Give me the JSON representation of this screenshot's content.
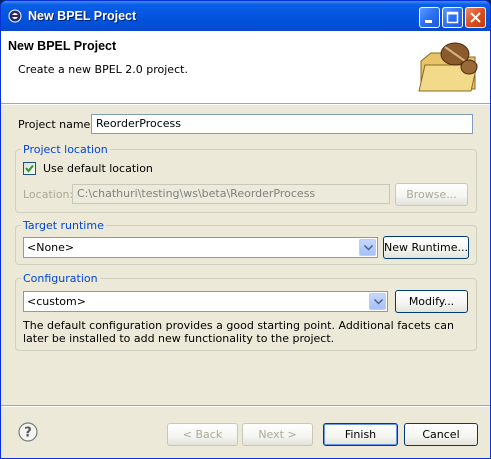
{
  "window": {
    "title": "New BPEL Project",
    "header_title": "New BPEL Project",
    "header_description": "Create a new BPEL 2.0 project."
  },
  "project": {
    "name_label": "Project name:",
    "name_value": "ReorderProcess"
  },
  "location": {
    "group_label": "Project location",
    "use_default_label": "Use default location",
    "use_default_checked": true,
    "location_label": "Location:",
    "location_value": "C:\\chathuri\\testing\\ws\\beta\\ReorderProcess",
    "browse_label": "Browse..."
  },
  "runtime": {
    "group_label": "Target runtime",
    "selected": "<None>",
    "new_runtime_label": "New Runtime..."
  },
  "configuration": {
    "group_label": "Configuration",
    "selected": "<custom>",
    "modify_label": "Modify...",
    "description": "The default configuration provides a good starting point. Additional facets can later be installed to add new functionality to the project."
  },
  "footer": {
    "back_label": "< Back",
    "next_label": "Next >",
    "finish_label": "Finish",
    "cancel_label": "Cancel"
  },
  "icons": {
    "app": "eclipse-icon",
    "header": "folder-bean-icon",
    "help": "help-icon"
  },
  "colors": {
    "titlebar": "#0050d8",
    "group_label": "#0046d5",
    "dialog_bg": "#ece9d8"
  }
}
